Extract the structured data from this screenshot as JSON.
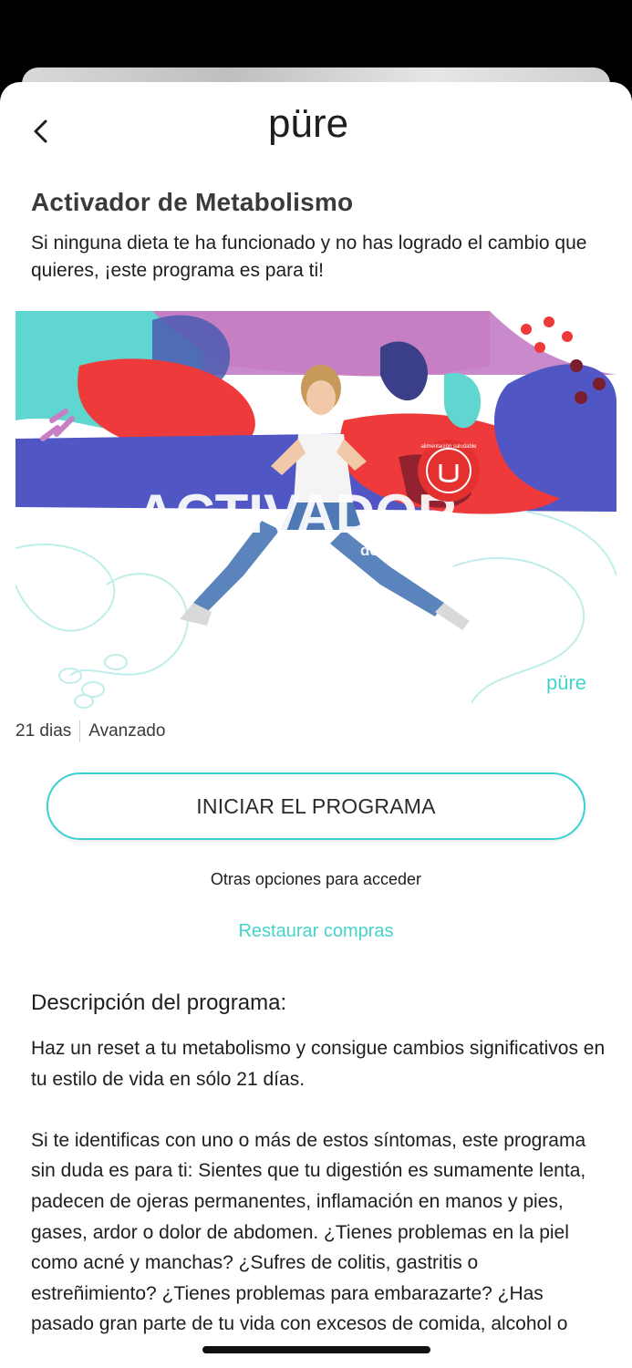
{
  "header": {
    "back_icon": "chevron-left-icon",
    "logo_text": "püre"
  },
  "program": {
    "title": "Activador de Metabolismo",
    "subtitle": "Si ninguna dieta te ha funcionado y no has logrado el cambio que quieres, ¡este programa es para ti!",
    "image": {
      "headline": "ACTIVADOR",
      "subheadline": "de metabolismo",
      "badge_text": "alimentación saludable",
      "watermark": "püre"
    },
    "duration": "21 dias",
    "level": "Avanzado"
  },
  "actions": {
    "start_label": "INICIAR EL PROGRAMA",
    "other_options_label": "Otras opciones para acceder",
    "restore_label": "Restaurar compras"
  },
  "description": {
    "heading": "Descripción del programa:",
    "paragraph_1": "Haz un reset a tu metabolismo y consigue cambios significativos en tu estilo de vida en sólo 21 días.",
    "paragraph_2": "Si te identificas con uno o más de estos síntomas, este programa sin duda es para ti: Sientes que tu digestión es sumamente lenta, padecen de ojeras permanentes, inflamación en manos y pies, gases, ardor o dolor de abdomen. ¿Tienes problemas en la piel como acné y manchas? ¿Sufres de colitis, gastritis o estreñimiento? ¿Tienes problemas para embarazarte? ¿Has pasado gran parte de tu vida con excesos de comida, alcohol o"
  },
  "colors": {
    "accent": "#46d3cc",
    "purple": "#c77fc4",
    "blue": "#5056c4",
    "red": "#ee3a3a",
    "teal": "#5fd6cf"
  }
}
